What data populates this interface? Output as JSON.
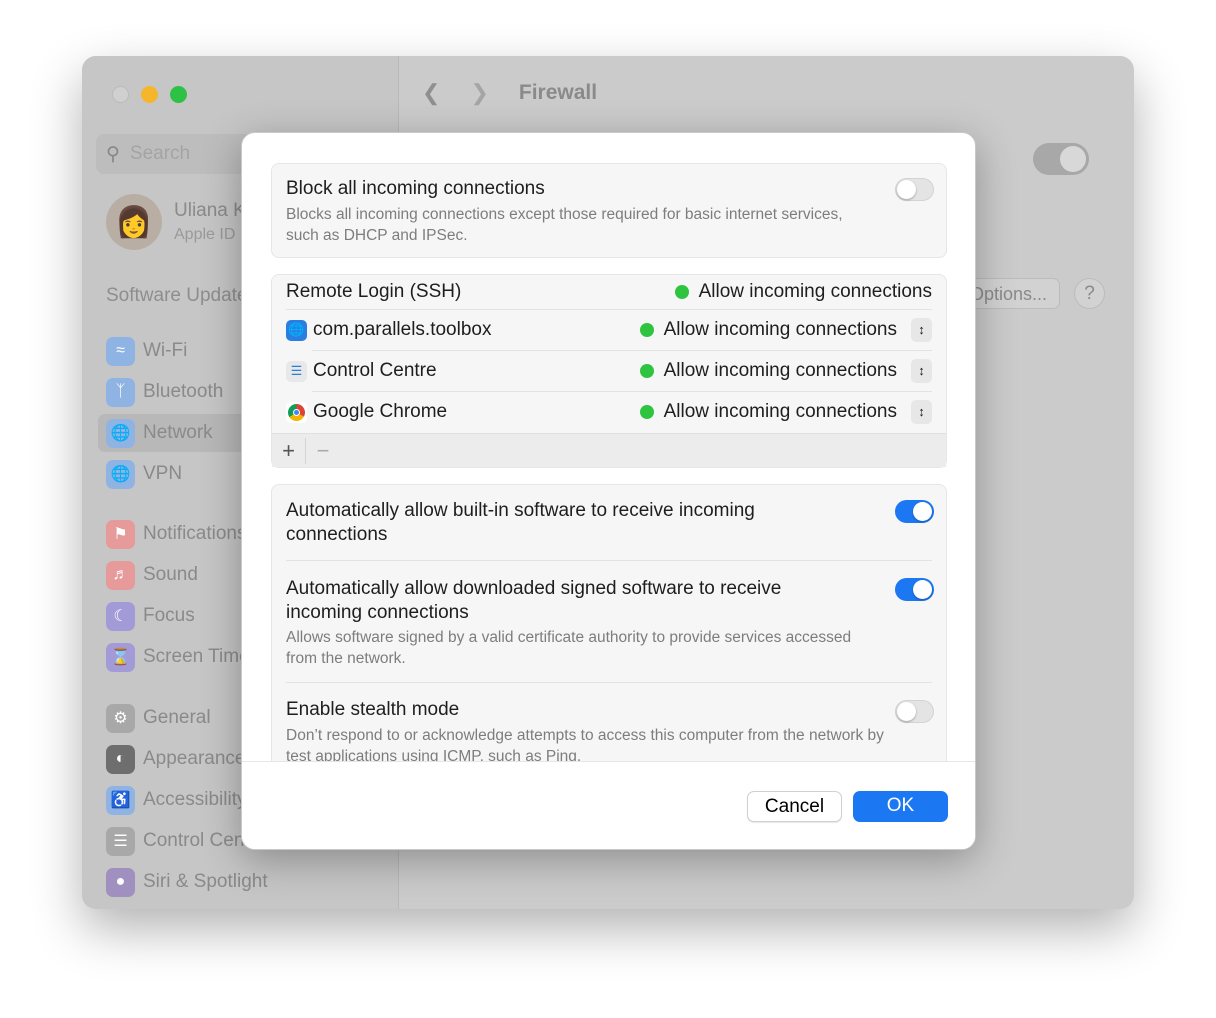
{
  "window": {
    "title": "Firewall",
    "colors": {
      "close": "#d0d0d0",
      "minimize": "#f5b62c",
      "zoom": "#2dc245",
      "accent": "#1c78f2",
      "status_green": "#2ec440"
    }
  },
  "sidebar": {
    "search_placeholder": "Search",
    "user": {
      "name": "Uliana K",
      "subtitle": "Apple ID"
    },
    "software_update": "Software Update",
    "items": [
      {
        "label": "Wi-Fi",
        "icon": "wifi-icon",
        "color": "#8fb4e3"
      },
      {
        "label": "Bluetooth",
        "icon": "bluetooth-icon",
        "color": "#8fb4e3"
      },
      {
        "label": "Network",
        "icon": "globe-icon",
        "color": "#8fb4e3",
        "selected": true
      },
      {
        "label": "VPN",
        "icon": "globe-icon",
        "color": "#8fb4e3"
      },
      {
        "label": "Notifications",
        "icon": "bell-icon",
        "color": "#e79a9a"
      },
      {
        "label": "Sound",
        "icon": "speaker-icon",
        "color": "#e79a9a"
      },
      {
        "label": "Focus",
        "icon": "moon-icon",
        "color": "#a29bd8"
      },
      {
        "label": "Screen Time",
        "icon": "hourglass-icon",
        "color": "#a29bd8"
      },
      {
        "label": "General",
        "icon": "gear-icon",
        "color": "#a8a8a8"
      },
      {
        "label": "Appearance",
        "icon": "appearance-icon",
        "color": "#6e6e6e"
      },
      {
        "label": "Accessibility",
        "icon": "accessibility-icon",
        "color": "#8fb4e3"
      },
      {
        "label": "Control Centre",
        "icon": "control-centre-icon",
        "color": "#a8a8a8"
      },
      {
        "label": "Siri & Spotlight",
        "icon": "siri-icon",
        "color": "#a090c0"
      }
    ]
  },
  "main": {
    "options_label": "Options...",
    "help_label": "?",
    "firewall_enabled": true
  },
  "dialog": {
    "block_all": {
      "title": "Block all incoming connections",
      "description": "Blocks all incoming connections except those required for basic internet services, such as DHCP and IPSec.",
      "enabled": false
    },
    "apps": [
      {
        "name": "Remote Login (SSH)",
        "status": "Allow incoming connections",
        "stepper": false
      },
      {
        "name": "com.parallels.toolbox",
        "status": "Allow incoming connections",
        "stepper": true,
        "icon": "globe-app-icon"
      },
      {
        "name": "Control Centre",
        "status": "Allow incoming connections",
        "stepper": true,
        "icon": "control-centre-icon"
      },
      {
        "name": "Google Chrome",
        "status": "Allow incoming connections",
        "stepper": true,
        "icon": "chrome-icon"
      }
    ],
    "add_label": "+",
    "remove_label": "−",
    "builtin": {
      "title": "Automatically allow built-in software to receive incoming connections",
      "enabled": true
    },
    "signed": {
      "title": "Automatically allow downloaded signed software to receive incoming connections",
      "description": "Allows software signed by a valid certificate authority to provide services accessed from the network.",
      "enabled": true
    },
    "stealth": {
      "title": "Enable stealth mode",
      "description": "Don’t respond to or acknowledge attempts to access this computer from the network by test applications using ICMP, such as Ping.",
      "enabled": false
    },
    "cancel_label": "Cancel",
    "ok_label": "OK"
  }
}
